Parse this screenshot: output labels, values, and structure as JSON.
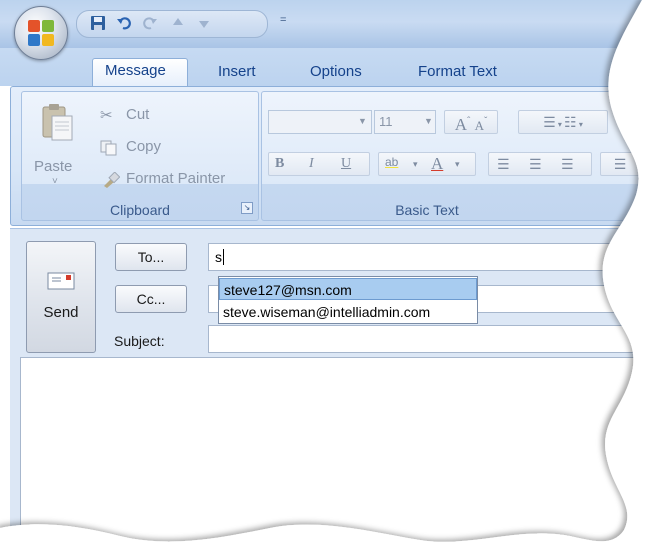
{
  "tabs": [
    {
      "label": "Message",
      "active": true
    },
    {
      "label": "Insert",
      "active": false
    },
    {
      "label": "Options",
      "active": false
    },
    {
      "label": "Format Text",
      "active": false
    }
  ],
  "quick_access": {
    "icons": [
      "save-icon",
      "undo-icon",
      "redo-icon",
      "up-arrow-icon",
      "down-arrow-icon"
    ],
    "more": "="
  },
  "clipboard": {
    "group_label": "Clipboard",
    "paste_label": "Paste",
    "paste_arrow": "˅",
    "cut_label": "Cut",
    "copy_label": "Copy",
    "format_painter_label": "Format Painter",
    "launcher": "↘"
  },
  "basic_text": {
    "group_label": "Basic Text",
    "font_name": "",
    "font_size": "11",
    "bold": "B",
    "italic": "I",
    "underline": "U",
    "grow_font": "A",
    "shrink_font": "A",
    "highlight": "ab",
    "font_color": "A"
  },
  "compose": {
    "send_label": "Send",
    "to_button": "To...",
    "cc_button": "Cc...",
    "subject_label": "Subject:",
    "to_value": "s",
    "cc_value": "",
    "subject_value": ""
  },
  "autocomplete": {
    "items": [
      "steve127@msn.com",
      "steve.wiseman@intelliadmin.com"
    ],
    "selected_index": 0
  },
  "colors": {
    "ribbon_bg": "#dde9f8",
    "tab_text": "#15428b",
    "selection": "#a8ccf0"
  }
}
